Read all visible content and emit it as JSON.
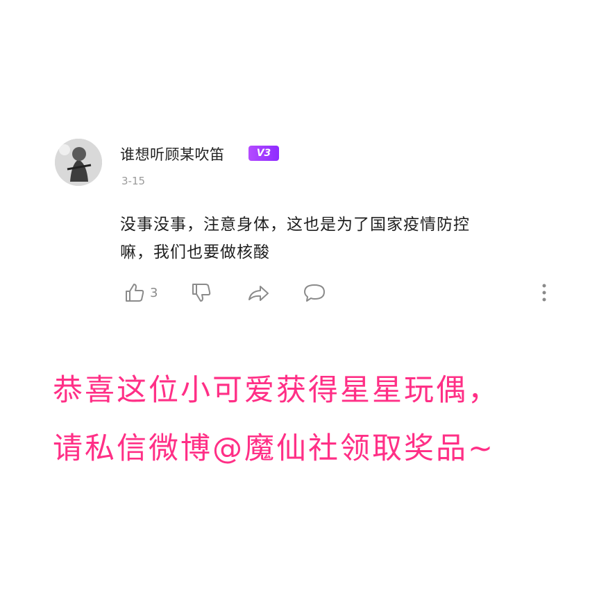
{
  "comment": {
    "username": "谁想听顾某吹笛",
    "badge": "V3",
    "date": "3-15",
    "text_line1": "没事没事，注意身体，这也是为了国家疫情防控",
    "text_line2": "嘛，我们也要做核酸",
    "like_count": "3",
    "icons": [
      "thumbs-up-icon",
      "thumbs-down-icon",
      "share-icon",
      "comment-icon",
      "more-icon"
    ]
  },
  "announcement": {
    "line1": "恭喜这位小可爱获得星星玩偶，",
    "line2": "请私信微博@魔仙社领取奖品~",
    "color": "#ff2f86"
  }
}
